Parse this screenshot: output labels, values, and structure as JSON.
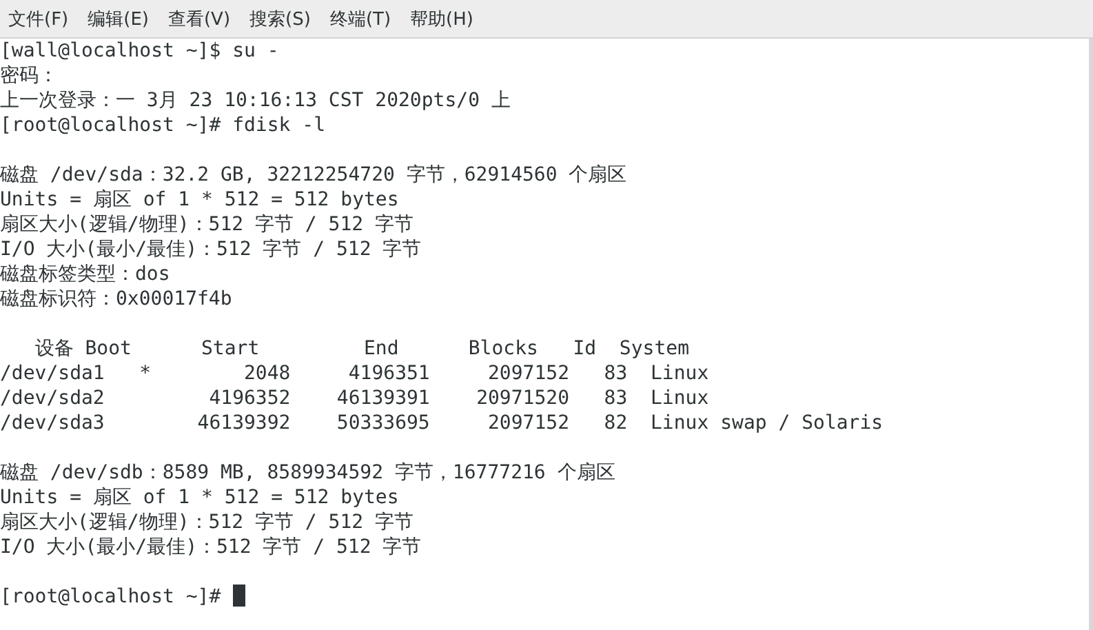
{
  "menu": [
    "文件(F)",
    "编辑(E)",
    "查看(V)",
    "搜索(S)",
    "终端(T)",
    "帮助(H)"
  ],
  "terminal": {
    "blocks": [
      [
        "[wall@localhost ~]$ su -",
        "密码：",
        "上一次登录：一 3月 23 10:16:13 CST 2020pts/0 上",
        "[root@localhost ~]# fdisk -l"
      ],
      [
        "磁盘 /dev/sda：32.2 GB, 32212254720 字节，62914560 个扇区",
        "Units = 扇区 of 1 * 512 = 512 bytes",
        "扇区大小(逻辑/物理)：512 字节 / 512 字节",
        "I/O 大小(最小/最佳)：512 字节 / 512 字节",
        "磁盘标签类型：dos",
        "磁盘标识符：0x00017f4b"
      ],
      [
        "   设备 Boot      Start         End      Blocks   Id  System",
        "/dev/sda1   *        2048     4196351     2097152   83  Linux",
        "/dev/sda2         4196352    46139391    20971520   83  Linux",
        "/dev/sda3        46139392    50333695     2097152   82  Linux swap / Solaris"
      ],
      [
        "磁盘 /dev/sdb：8589 MB, 8589934592 字节，16777216 个扇区",
        "Units = 扇区 of 1 * 512 = 512 bytes",
        "扇区大小(逻辑/物理)：512 字节 / 512 字节",
        "I/O 大小(最小/最佳)：512 字节 / 512 字节"
      ],
      [
        "[root@localhost ~]# "
      ]
    ],
    "cursor": true
  }
}
